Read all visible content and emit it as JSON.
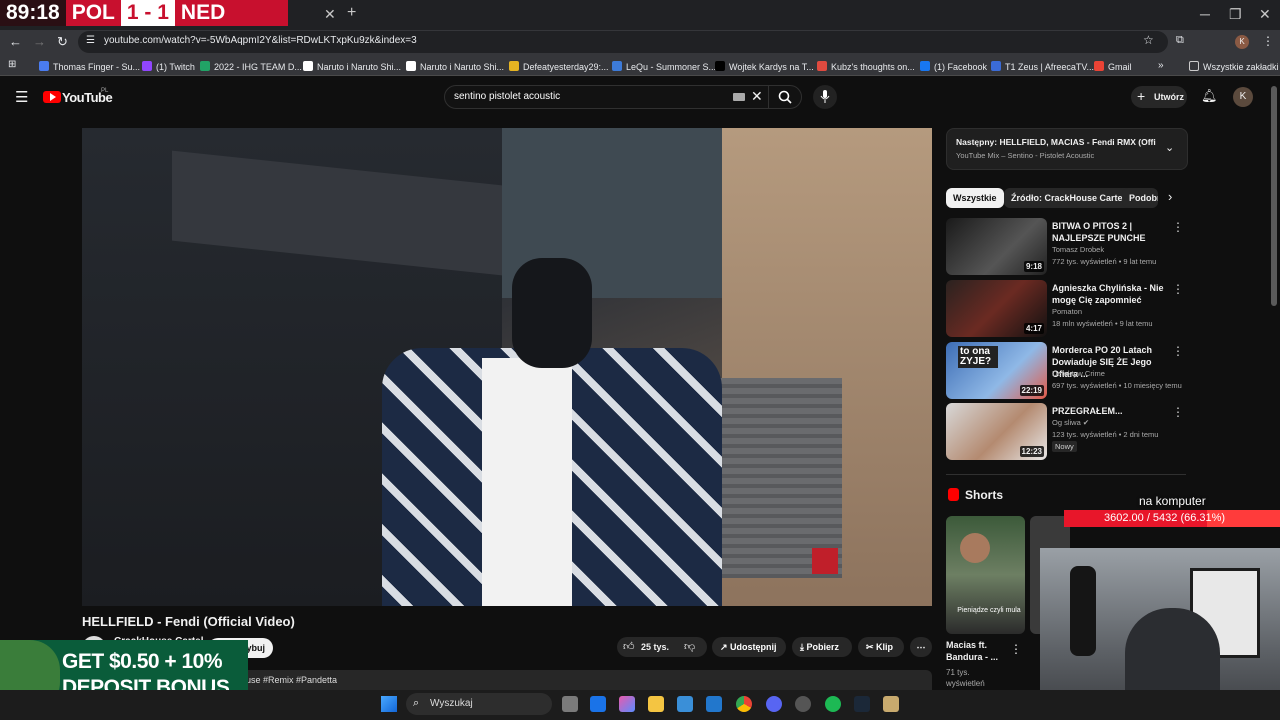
{
  "scoreboard": {
    "time": "89:18",
    "team_a": "POL",
    "score": "1 - 1",
    "team_b": "NED"
  },
  "browser": {
    "url": "youtube.com/watch?v=-5WbAqpmI2Y&list=RDwLKTxpKu9zk&index=3",
    "bookmarks": [
      {
        "label": "Thomas Finger - Su...",
        "color": "#4a7cf0"
      },
      {
        "label": "(1) Twitch",
        "color": "#9146ff"
      },
      {
        "label": "2022 - IHG TEAM D...",
        "color": "#21a366"
      },
      {
        "label": "Naruto i Naruto Shi...",
        "color": "#ffffff"
      },
      {
        "label": "Naruto i Naruto Shi...",
        "color": "#ffffff"
      },
      {
        "label": "Defeatyesterday29:...",
        "color": "#e6b422"
      },
      {
        "label": "LeQu - Summoner S...",
        "color": "#3d7bd9"
      },
      {
        "label": "Wojtek Kardys na T...",
        "color": "#000000"
      },
      {
        "label": "Kubz's thoughts on...",
        "color": "#e04a3f"
      },
      {
        "label": "(1) Facebook",
        "color": "#1877f2"
      },
      {
        "label": "T1 Zeus | AfreecaTV...",
        "color": "#3b6bd6"
      },
      {
        "label": "Gmail",
        "color": "#ea4335"
      }
    ],
    "all_bookmarks": "Wszystkie zakładki"
  },
  "youtube": {
    "logo": "YouTube",
    "country": "PL",
    "search_value": "sentino pistolet acoustic",
    "create_label": "Utwórz",
    "avatar_letter": "K",
    "video_title": "HELLFIELD - Fendi (Official Video)",
    "channel": "CrackHouse Cartel",
    "subscribe": "Subskrybuj",
    "likes": "25 tys.",
    "share": "Udostępnij",
    "download": "Pobierz",
    "clip": "Klip",
    "desc_tags": "use #Remix #Pandetta",
    "next_title": "Następny: HELLFIELD, MACIAS - Fendi RMX (Officia...",
    "next_sub": "YouTube Mix – Sentino - Pistolet Acoustic",
    "chips": [
      "Wszystkie",
      "Źródło: CrackHouse Cartel",
      "Podobne"
    ],
    "recs": [
      {
        "title": "BITWA O PITOS 2 | NAJLEPSZE PUNCHE",
        "channel": "Tomasz Drobek",
        "meta": "772 tys. wyświetleń • 9 lat temu",
        "dur": "9:18",
        "badge": ""
      },
      {
        "title": "Agnieszka Chylińska - Nie mogę Cię zapomnieć",
        "channel": "Pomaton",
        "meta": "18 mln wyświetleń • 9 lat temu",
        "dur": "4:17",
        "badge": ""
      },
      {
        "title": "Morderca PO 20 Latach Dowiaduje SIĘ ŻE Jego Ofiara ...",
        "channel": "Detektyw Crime",
        "meta": "697 tys. wyświetleń • 10 miesięcy temu",
        "dur": "22:19",
        "badge": ""
      },
      {
        "title": "PRZEGRAŁEM...",
        "channel": "Og sliwa",
        "meta": "123 tys. wyświetleń • 2 dni temu",
        "dur": "12:23",
        "badge": "Nowy"
      }
    ],
    "thumb3_text": "to ona ZYJE?",
    "shorts_label": "Shorts",
    "short1_caption": "Pieniądze czyli mula",
    "short1_title": "Macias ft. Bandura - ...",
    "short1_views": "71 tys. wyświetleń"
  },
  "overlay": {
    "donation_label": "na komputer",
    "donation_value": "3602.00 / 5432 (66.31%)",
    "donation_fraction": 0.6631,
    "ad_line1": "GET $0.50 + 10%",
    "ad_line2": "DEPOSIT BONUS"
  },
  "taskbar": {
    "search_placeholder": "Wyszukaj"
  }
}
